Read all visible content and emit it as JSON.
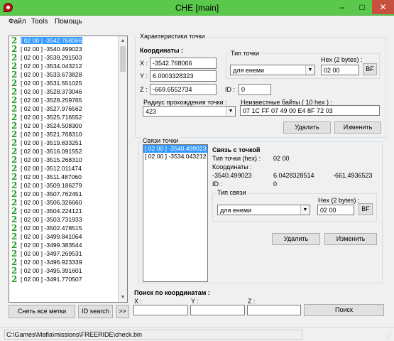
{
  "window": {
    "title": "CHE [main]",
    "minimize": "–",
    "maximize": "□",
    "close": "✕"
  },
  "menu": [
    "Файл",
    "Tools",
    "Помощь"
  ],
  "points_list": {
    "selected_index": 0,
    "items": [
      "[ 02 00 ] -3542.768066",
      "[ 02 00 ] -3540.499023",
      "[ 02 00 ] -3539.291503",
      "[ 02 00 ] -3534.043212",
      "[ 02 00 ] -3533.673828",
      "[ 02 00 ] -3531.551025",
      "[ 02 00 ] -3528.373046",
      "[ 02 00 ] -3528.259765",
      "[ 02 00 ] -3527.976562",
      "[ 02 00 ] -3525.716552",
      "[ 02 00 ] -3524.508300",
      "[ 02 00 ] -3521.768310",
      "[ 02 00 ] -3519.833251",
      "[ 02 00 ] -3516.091552",
      "[ 02 00 ] -3515.268310",
      "[ 02 00 ] -3512.011474",
      "[ 02 00 ] -3511.487060",
      "[ 02 00 ] -3509.186279",
      "[ 02 00 ] -3507.762451",
      "[ 02 00 ] -3506.326660",
      "[ 02 00 ] -3504.224121",
      "[ 02 00 ] -3503.731933",
      "[ 02 00 ] -3502.478515",
      "[ 02 00 ] -3499.841064",
      "[ 02 00 ] -3499.383544",
      "[ 02 00 ] -3497.269531",
      "[ 02 00 ] -3496.923339",
      "[ 02 00 ] -3495.391601",
      "[ 02 00 ] -3491.770507"
    ]
  },
  "bottom_left": {
    "clear_marks": "Снять все метки",
    "id_search": "ID search",
    "next": ">>"
  },
  "point_props": {
    "group_title": "Характеристики точки",
    "coords_label": "Координаты :",
    "x_label": "X :",
    "x_value": "-3542.768066",
    "y_label": "Y :",
    "y_value": "6.0003328323",
    "z_label": "Z :",
    "z_value": "-669.6552734",
    "id_label": "ID :",
    "id_value": "0",
    "type_group": "Тип точки",
    "type_value": "для енеми",
    "hex_label": "Hex (2 bytes) :",
    "hex_value": "02 00",
    "bf_label": "BF",
    "radius_label": "Радиус прохождения точки :",
    "radius_value": "423",
    "unknown_label": "Неизвестные байты ( 10 hex ) :",
    "unknown_value": "07 1C FF 07 49 00 E4 8F 72 03",
    "delete_label": "Удалить",
    "edit_label": "Изменить"
  },
  "links": {
    "group_title": "Связи точки",
    "items": [
      "[ 02 00 ] -3540.499023",
      "[ 02 00 ] -3534.043212"
    ],
    "selected_index": 0,
    "link_title": "Связь с точкой",
    "type_hex_label": "Тип точки (hex) :",
    "type_hex_value": "02 00",
    "coords_label": "Координаты :",
    "coord_x": "-3540.499023",
    "coord_y": "6.0428328514",
    "coord_z": "-661.4936523",
    "id_label": "ID :",
    "id_value": "0",
    "link_type_group": "Тип связи",
    "link_type_value": "для енеми",
    "hex_label": "Hex (2 bytes) :",
    "hex_value": "02 00",
    "bf_label": "BF",
    "delete_label": "Удалить",
    "edit_label": "Изменить"
  },
  "search": {
    "title": "Поиск по координатам :",
    "x_label": "X :",
    "y_label": "Y :",
    "z_label": "Z :",
    "x_value": "",
    "y_value": "",
    "z_value": "",
    "button": "Поиск"
  },
  "status": {
    "path": "C:\\Games\\Mafia\\missions\\FREERIDE\\check.bin"
  },
  "colors": {
    "titlebar": "#5ac84b",
    "selection": "#3399ff",
    "list_icon": "#1e9a1e",
    "close": "#c7503f"
  }
}
